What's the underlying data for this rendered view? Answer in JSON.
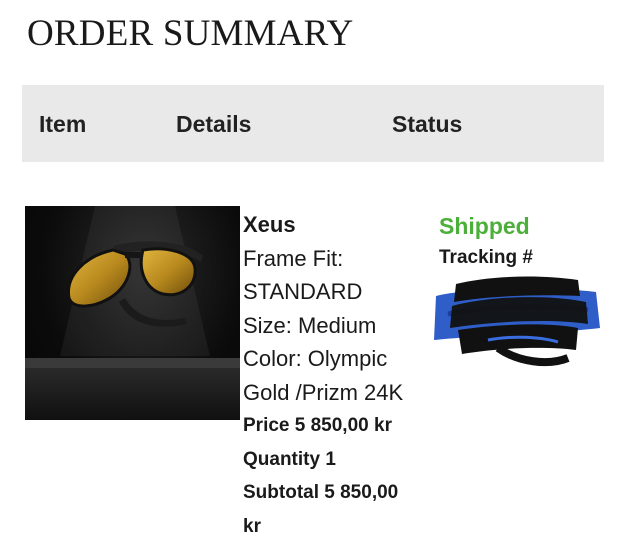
{
  "page": {
    "title": "ORDER SUMMARY"
  },
  "table": {
    "headers": {
      "item": "Item",
      "details": "Details",
      "status": "Status"
    }
  },
  "order_item": {
    "image_icon": "sunglasses-product-image",
    "name": "Xeus",
    "frame_fit_label": "Frame Fit:",
    "frame_fit_value": "STANDARD",
    "size_line": "Size:  Medium",
    "color_line_1": "Color:  Olympic",
    "color_line_2": "Gold /Prizm 24K",
    "price": "Price 5 850,00 kr",
    "quantity": "Quantity 1",
    "subtotal_line_1": "Subtotal 5 850,00",
    "subtotal_line_2": "kr"
  },
  "status": {
    "state": "Shipped",
    "state_color": "#4caf3a",
    "tracking_label": "Tracking #"
  },
  "colors": {
    "header_background": "#e9e9e9",
    "redaction_blue": "#2f5ec9"
  }
}
